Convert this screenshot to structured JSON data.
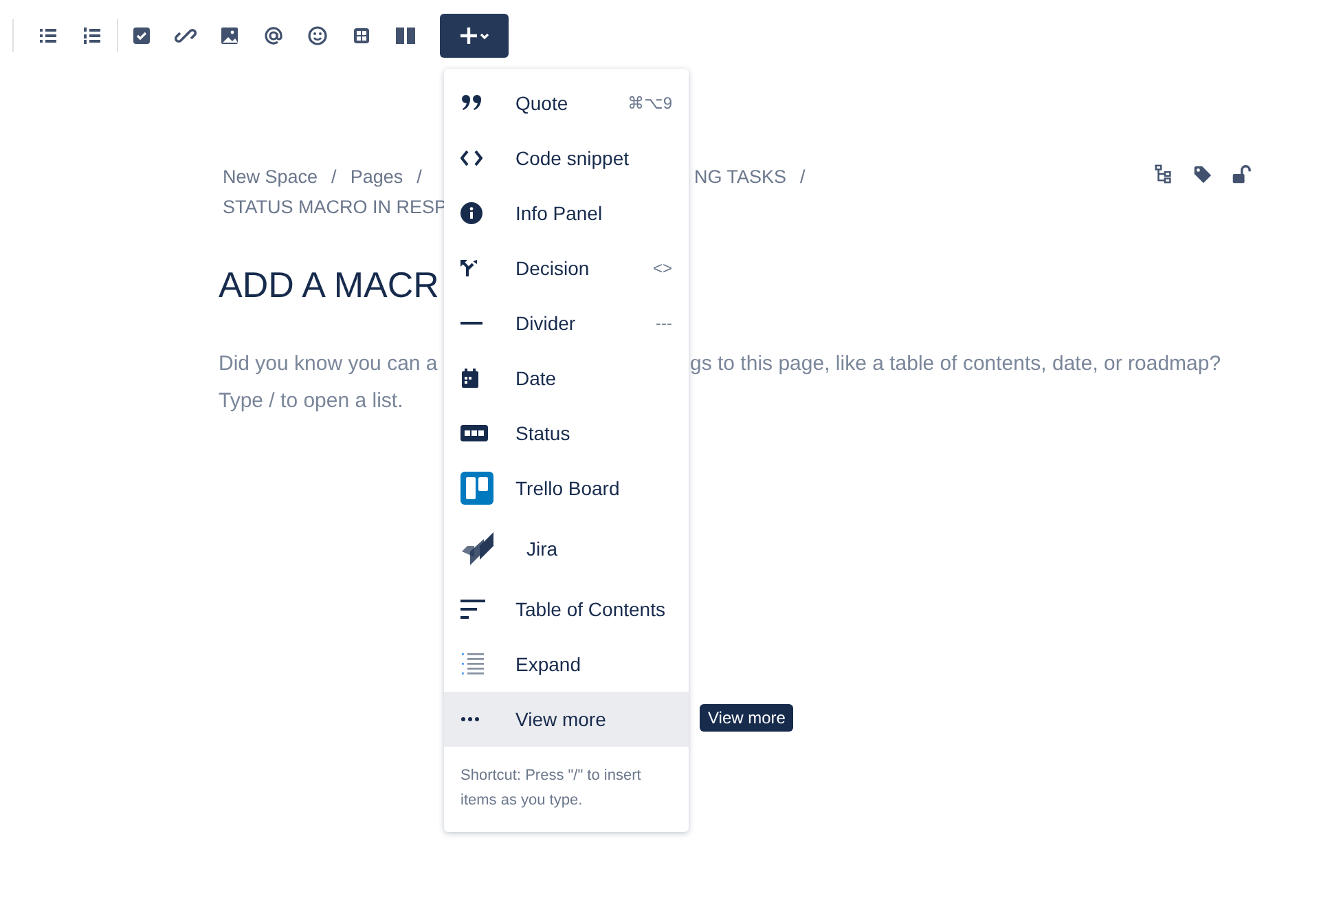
{
  "breadcrumb": {
    "left": [
      "New Space",
      "/",
      "Pages",
      "/"
    ],
    "right": [
      "NG TASKS",
      "/"
    ],
    "line2": "STATUS MACRO IN RESP"
  },
  "heading": "ADD A MACR",
  "paragraph": {
    "line1_left": "Did you know you can a",
    "line1_right": "gs to this page, like a table of contents, date, or roadmap?",
    "line2": "Type / to open a list."
  },
  "insert_menu": {
    "items": [
      {
        "label": "Quote",
        "shortcut": "⌘⌥9",
        "selected": false
      },
      {
        "label": "Code snippet",
        "selected": false
      },
      {
        "label": "Info Panel",
        "selected": false
      },
      {
        "label": "Decision",
        "shortcut": "<>",
        "selected": false
      },
      {
        "label": "Divider",
        "shortcut": "---",
        "selected": false
      },
      {
        "label": "Date",
        "selected": false
      },
      {
        "label": "Status",
        "selected": false
      },
      {
        "label": "Trello Board",
        "selected": false
      },
      {
        "label": "Jira",
        "selected": false
      },
      {
        "label": "Table of Contents",
        "selected": false
      },
      {
        "label": "Expand",
        "selected": false
      },
      {
        "label": "View more",
        "selected": true
      }
    ],
    "footer": "Shortcut: Press \"/\" to insert items as you type."
  },
  "tooltip": "View more"
}
